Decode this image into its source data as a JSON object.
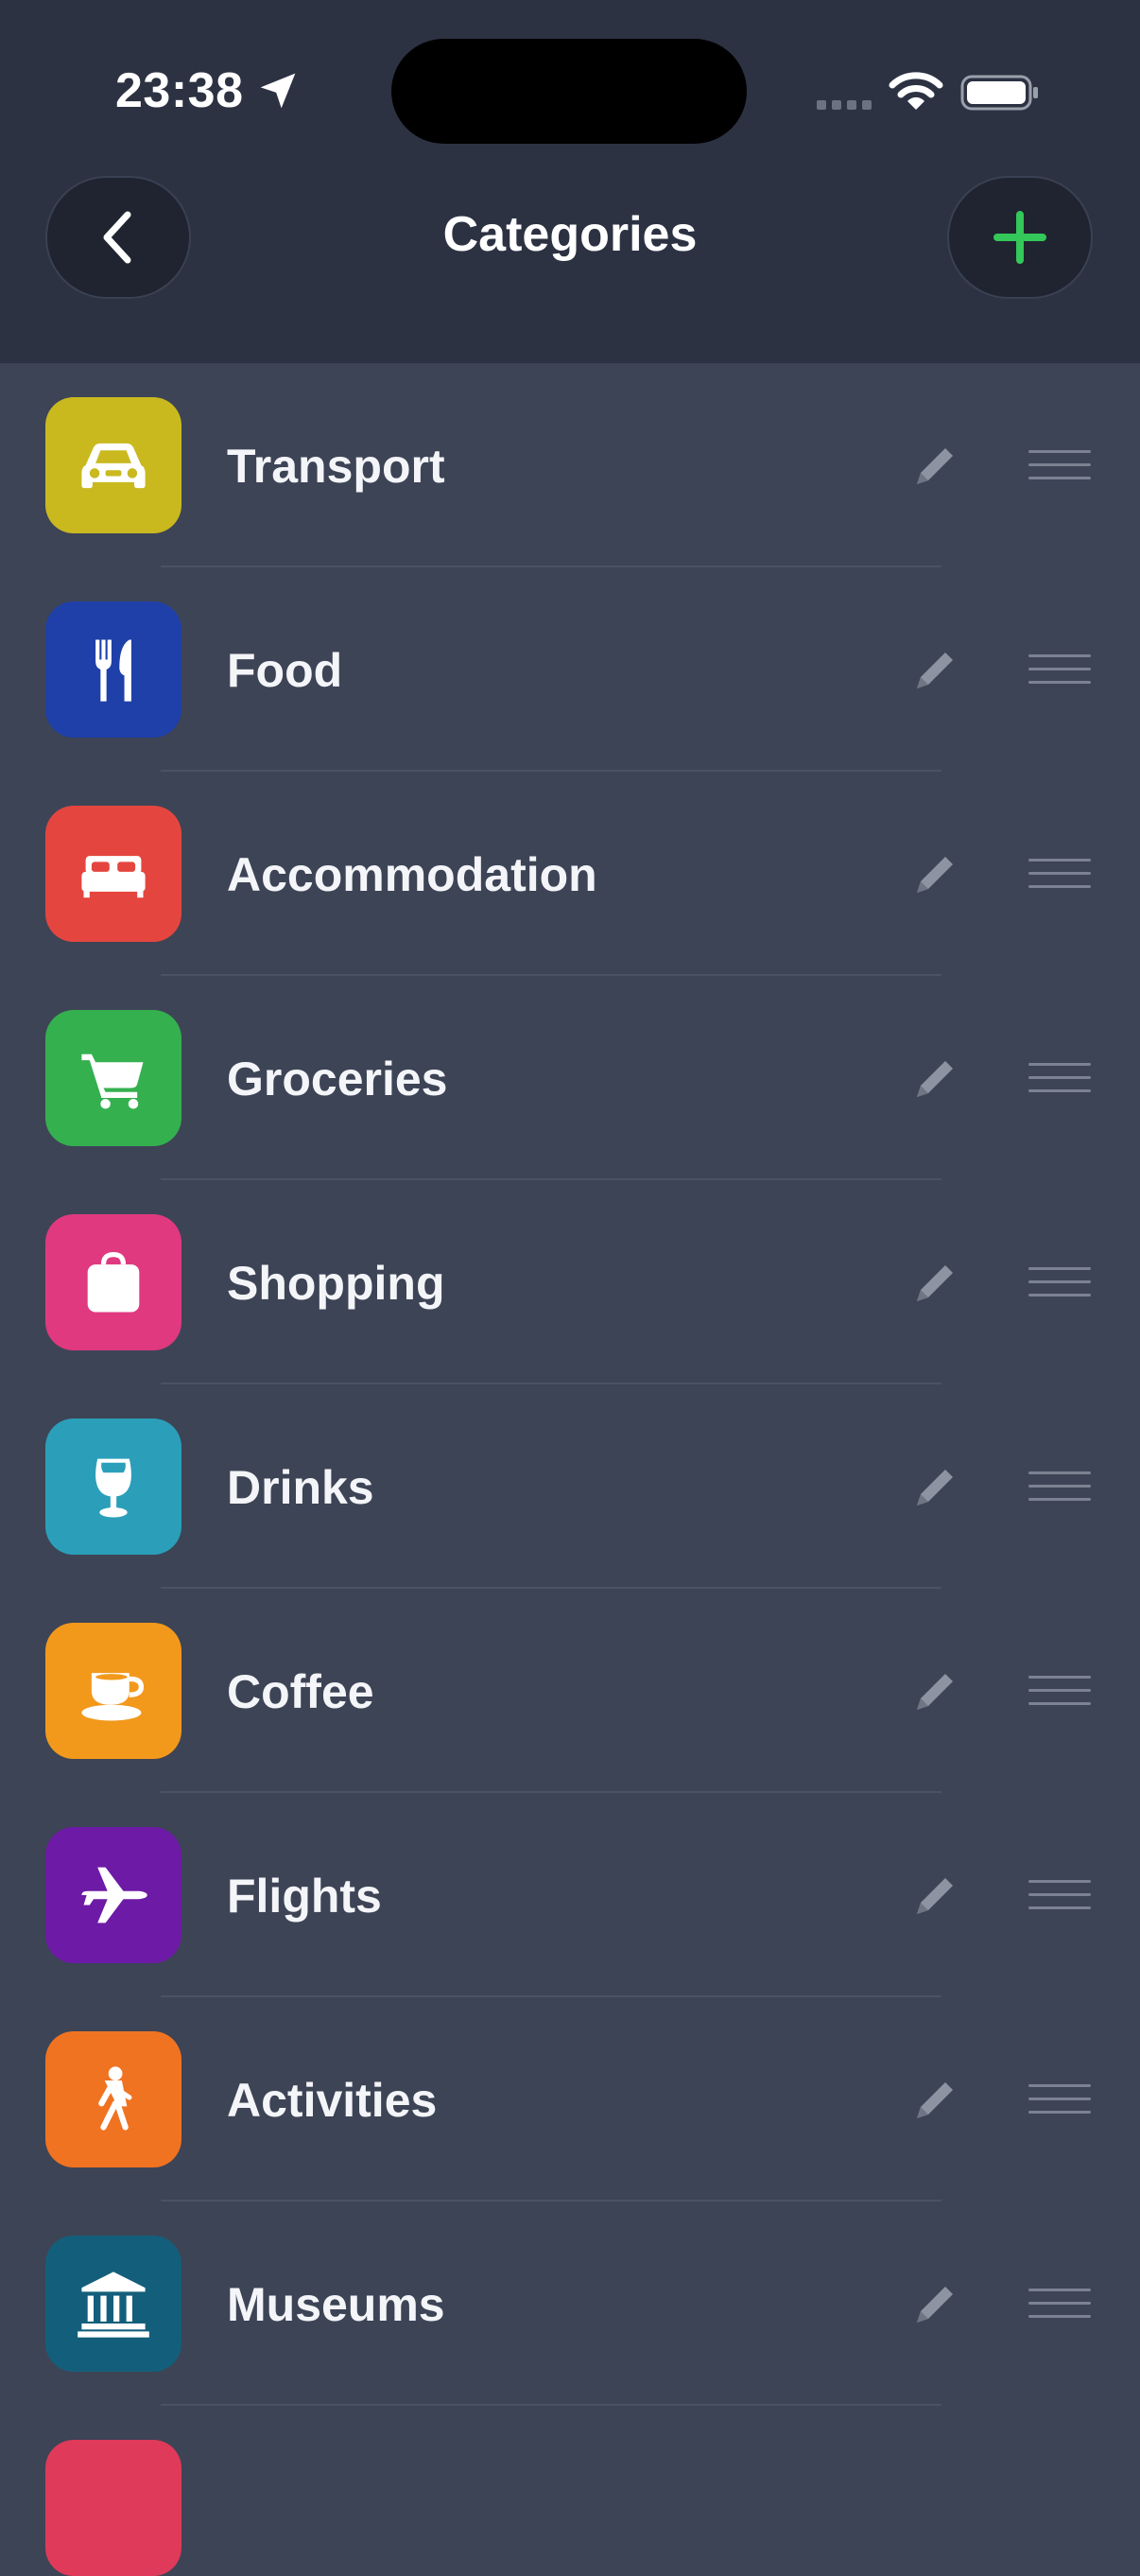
{
  "status_bar": {
    "time": "23:38"
  },
  "nav": {
    "title": "Categories"
  },
  "colors": {
    "accent": "#34c759",
    "header_bg": "#2c3242",
    "list_bg": "#3d4456"
  },
  "categories": [
    {
      "label": "Transport",
      "icon": "car-icon",
      "color": "#c9b91f"
    },
    {
      "label": "Food",
      "icon": "fork-knife-icon",
      "color": "#1e40a8"
    },
    {
      "label": "Accommodation",
      "icon": "bed-icon",
      "color": "#e4463f"
    },
    {
      "label": "Groceries",
      "icon": "cart-icon",
      "color": "#35b04f"
    },
    {
      "label": "Shopping",
      "icon": "bag-icon",
      "color": "#e0397f"
    },
    {
      "label": "Drinks",
      "icon": "wine-glass-icon",
      "color": "#2b9fb9"
    },
    {
      "label": "Coffee",
      "icon": "coffee-cup-icon",
      "color": "#f2991c"
    },
    {
      "label": "Flights",
      "icon": "airplane-icon",
      "color": "#6d1aa6"
    },
    {
      "label": "Activities",
      "icon": "walking-person-icon",
      "color": "#f07322"
    },
    {
      "label": "Museums",
      "icon": "museum-icon",
      "color": "#135f7b"
    }
  ]
}
